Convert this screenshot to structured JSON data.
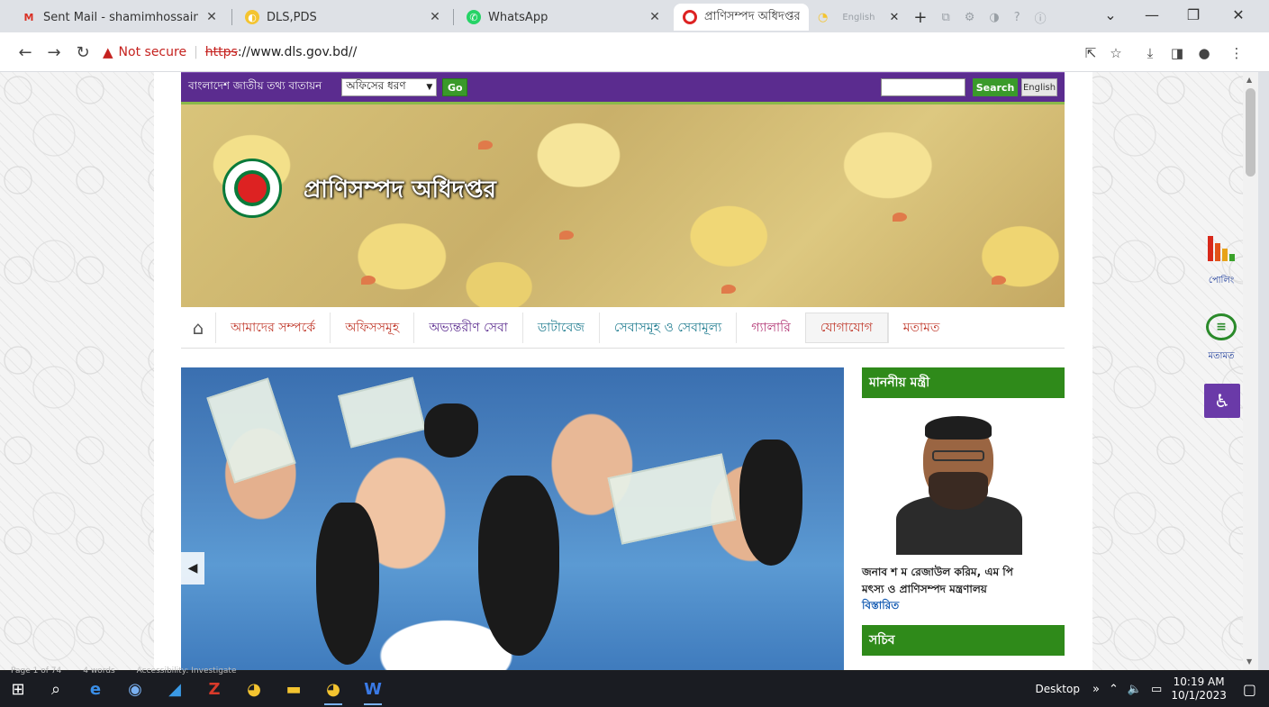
{
  "browser": {
    "tabs": [
      {
        "title": "Sent Mail - shamimhossainlms@",
        "favicon": "gmail-icon",
        "active": false
      },
      {
        "title": "DLS,PDS",
        "favicon": "chrome-page-icon",
        "active": false
      },
      {
        "title": "WhatsApp",
        "favicon": "whatsapp-icon",
        "active": false
      },
      {
        "title": "প্রাণিসম্পদ অধিদপ্তর",
        "favicon": "dls-icon",
        "active": true
      }
    ],
    "extension_label": "English",
    "security_label": "Not secure",
    "url_scheme": "https",
    "url_rest": "://www.dls.gov.bd//"
  },
  "portal_bar": {
    "portal_name": "বাংলাদেশ জাতীয় তথ্য বাতায়ন",
    "office_type_select": "অফিসের ধরণ",
    "go_label": "Go",
    "search_label": "Search",
    "language_label": "English"
  },
  "banner": {
    "site_title": "প্রাণিসম্পদ অধিদপ্তর"
  },
  "main_menu": {
    "items": [
      "আমাদের সম্পর্কে",
      "অফিসসমূহ",
      "অভ্যন্তরীণ সেবা",
      "ডাটাবেজ",
      "সেবাসমূহ ও সেবামূল্য",
      "গ্যালারি",
      "যোগাযোগ",
      "মতামত"
    ]
  },
  "right_column": {
    "minister_heading": "মাননীয় মন্ত্রী",
    "minister_name": "জনাব শ ম রেজাউল করিম, এম পি",
    "ministry": "মৎস্য ও প্রাণিসম্পদ মন্ত্রণালয়",
    "details_link": "বিস্তারিত",
    "secretary_heading": "সচিব"
  },
  "side_widgets": {
    "poll_label": "পোলিং",
    "feedback_label": "মতামত"
  },
  "word_status": {
    "page": "Page 1 of 74",
    "words": "4 words",
    "accessibility": "Accessibility: Investigate"
  },
  "taskbar": {
    "desktop_label": "Desktop",
    "time": "10:19 AM",
    "date": "10/1/2023"
  },
  "colors": {
    "portal_purple": "#5b2c8f",
    "heading_green": "#2f8a1a",
    "button_green": "#3a9a2a",
    "insecure_red": "#c5221f"
  }
}
